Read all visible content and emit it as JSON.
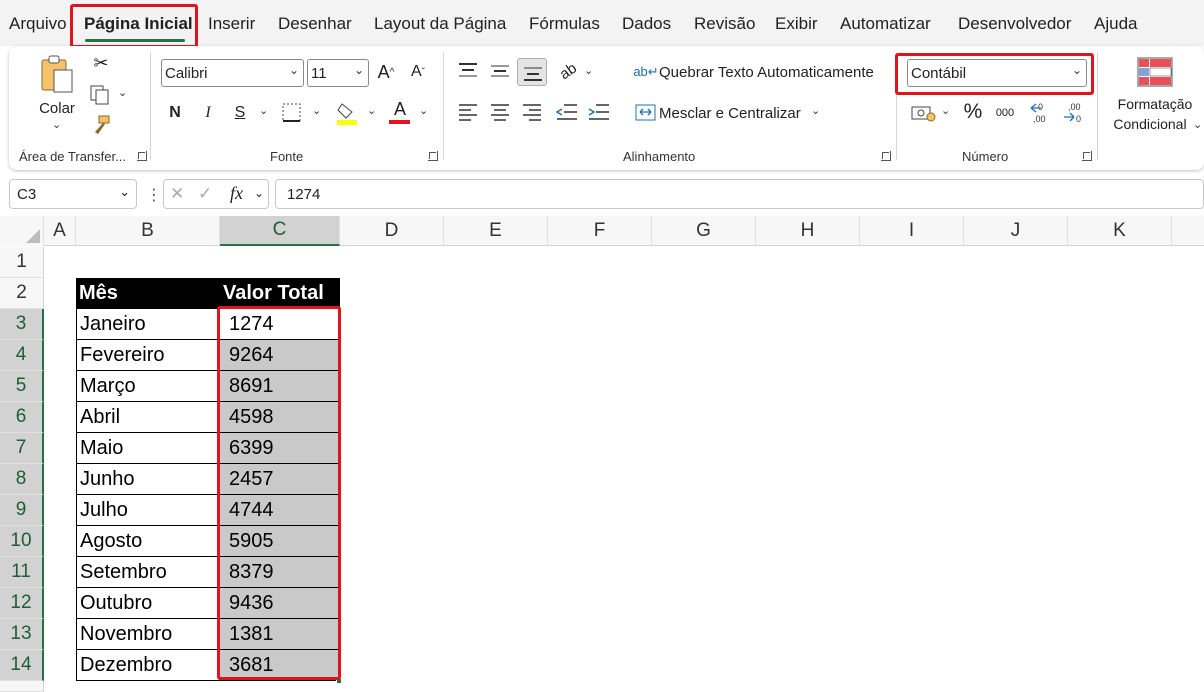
{
  "menu": {
    "items": [
      "Arquivo",
      "Página Inicial",
      "Inserir",
      "Desenhar",
      "Layout da Página",
      "Fórmulas",
      "Dados",
      "Revisão",
      "Exibir",
      "Automatizar",
      "Desenvolvedor",
      "Ajuda"
    ],
    "active_index": 1
  },
  "ribbon": {
    "clipboard": {
      "paste_label": "Colar",
      "group_label": "Área de Transfer..."
    },
    "font": {
      "font_name": "Calibri",
      "font_size": "11",
      "group_label": "Fonte",
      "bold": "N",
      "italic": "I",
      "underline": "S"
    },
    "alignment": {
      "wrap_label": "Quebrar Texto Automaticamente",
      "merge_label": "Mesclar e Centralizar",
      "group_label": "Alinhamento"
    },
    "number": {
      "format": "Contábil",
      "percent": "%",
      "thousands": "000",
      "group_label": "Número"
    },
    "styles": {
      "cond_format_line1": "Formatação",
      "cond_format_line2": "Condicional"
    }
  },
  "formula_bar": {
    "name_box": "C3",
    "fx": "fx",
    "value": "1274"
  },
  "grid": {
    "columns": [
      "A",
      "B",
      "C",
      "D",
      "E",
      "F",
      "G",
      "H",
      "I",
      "J",
      "K"
    ],
    "selected_column": "C",
    "rows": [
      "1",
      "2",
      "3",
      "4",
      "5",
      "6",
      "7",
      "8",
      "9",
      "10",
      "11",
      "12",
      "13",
      "14"
    ],
    "selected_rows": [
      "3",
      "4",
      "5",
      "6",
      "7",
      "8",
      "9",
      "10",
      "11",
      "12",
      "13",
      "14"
    ]
  },
  "table": {
    "headers": [
      "Mês",
      "Valor Total"
    ],
    "rows": [
      [
        "Janeiro",
        "1274"
      ],
      [
        "Fevereiro",
        "9264"
      ],
      [
        "Março",
        "8691"
      ],
      [
        "Abril",
        "4598"
      ],
      [
        "Maio",
        "6399"
      ],
      [
        "Junho",
        "2457"
      ],
      [
        "Julho",
        "4744"
      ],
      [
        "Agosto",
        "5905"
      ],
      [
        "Setembro",
        "8379"
      ],
      [
        "Outubro",
        "9436"
      ],
      [
        "Novembro",
        "1381"
      ],
      [
        "Dezembro",
        "3681"
      ]
    ]
  },
  "colors": {
    "accent": "#217346",
    "highlight_red": "#e0141c",
    "selection_fill": "#c9c9c9"
  }
}
